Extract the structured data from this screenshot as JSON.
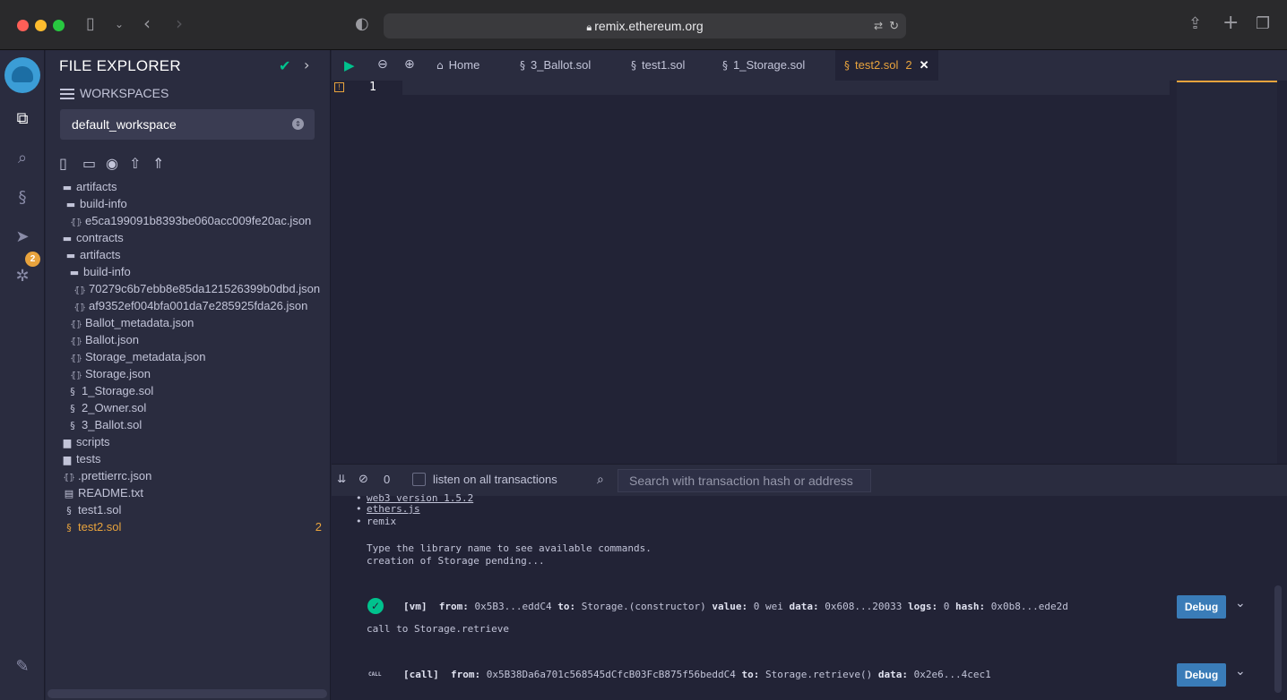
{
  "browser": {
    "url": "remix.ethereum.org"
  },
  "sidebar": {
    "title": "FILE EXPLORER",
    "workspaces_label": "WORKSPACES",
    "workspace_selected": "default_workspace",
    "git_badge": "2"
  },
  "tree": [
    {
      "label": "artifacts",
      "type": "folder-open",
      "indent": 0
    },
    {
      "label": "build-info",
      "type": "folder-open",
      "indent": 1
    },
    {
      "label": "e5ca199091b8393be060acc009fe20ac.json",
      "type": "json",
      "indent": 2
    },
    {
      "label": "contracts",
      "type": "folder-open",
      "indent": 0
    },
    {
      "label": "artifacts",
      "type": "folder-open",
      "indent": 1
    },
    {
      "label": "build-info",
      "type": "folder-open",
      "indent": 2
    },
    {
      "label": "70279c6b7ebb8e85da121526399b0dbd.json",
      "type": "json",
      "indent": 3
    },
    {
      "label": "af9352ef004bfa001da7e285925fda26.json",
      "type": "json",
      "indent": 3
    },
    {
      "label": "Ballot_metadata.json",
      "type": "json",
      "indent": 2
    },
    {
      "label": "Ballot.json",
      "type": "json",
      "indent": 2
    },
    {
      "label": "Storage_metadata.json",
      "type": "json",
      "indent": 2
    },
    {
      "label": "Storage.json",
      "type": "json",
      "indent": 2
    },
    {
      "label": "1_Storage.sol",
      "type": "sol",
      "indent": 1
    },
    {
      "label": "2_Owner.sol",
      "type": "sol",
      "indent": 1
    },
    {
      "label": "3_Ballot.sol",
      "type": "sol",
      "indent": 1
    },
    {
      "label": "scripts",
      "type": "folder",
      "indent": 0
    },
    {
      "label": "tests",
      "type": "folder",
      "indent": 0
    },
    {
      "label": ".prettierrc.json",
      "type": "json",
      "indent": 0
    },
    {
      "label": "README.txt",
      "type": "txt",
      "indent": 0
    },
    {
      "label": "test1.sol",
      "type": "sol",
      "indent": 0
    },
    {
      "label": "test2.sol",
      "type": "sol",
      "indent": 0,
      "active": true,
      "count": "2"
    }
  ],
  "tabs": [
    {
      "label": "Home",
      "icon": "home-icon"
    },
    {
      "label": "3_Ballot.sol",
      "icon": "solidity-icon"
    },
    {
      "label": "test1.sol",
      "icon": "solidity-icon"
    },
    {
      "label": "1_Storage.sol",
      "icon": "solidity-icon"
    },
    {
      "label": "test2.sol",
      "icon": "solidity-icon",
      "active": true,
      "count": "2"
    }
  ],
  "editor": {
    "line_number": "1"
  },
  "terminal": {
    "tx_count": "0",
    "listen_label": "listen on all transactions",
    "search_placeholder": "Search with transaction hash or address",
    "lib_web3": "web3 version 1.5.2",
    "lib_ethers": "ethers.js",
    "lib_remix": "remix",
    "hint": "Type the library name to see available commands.",
    "pending": "creation of Storage pending...",
    "tx1": {
      "tag": "[vm]",
      "from_label": "from:",
      "from": "0x5B3...eddC4",
      "to_label": "to:",
      "to": "Storage.(constructor)",
      "value_label": "value:",
      "value": "0 wei",
      "data_label": "data:",
      "data": "0x608...20033",
      "logs_label": "logs:",
      "logs": "0",
      "hash_label": "hash:",
      "hash": "0x0b8...ede2d"
    },
    "call_msg": "call to Storage.retrieve",
    "tx2": {
      "badge": "CALL",
      "tag": "[call]",
      "from_label": "from:",
      "from": "0x5B38Da6a701c568545dCfcB03FcB875f56beddC4",
      "to_label": "to:",
      "to": "Storage.retrieve()",
      "data_label": "data:",
      "data": "0x2e6...4cec1"
    },
    "debug_label": "Debug"
  }
}
